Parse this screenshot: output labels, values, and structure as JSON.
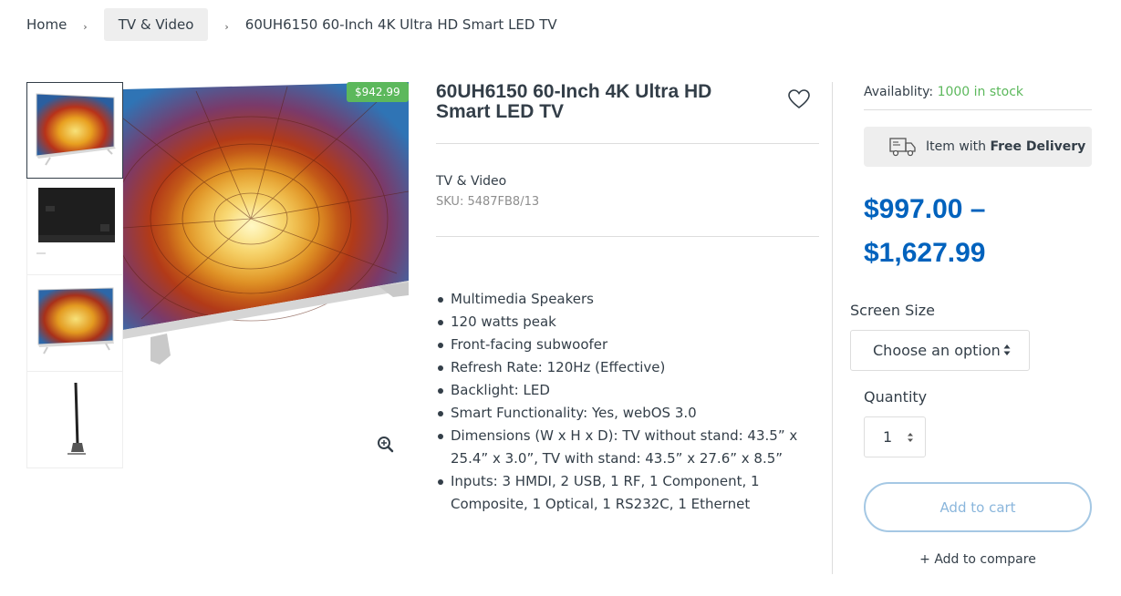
{
  "breadcrumb": {
    "home": "Home",
    "category": "TV & Video",
    "current": "60UH6150 60-Inch 4K Ultra HD Smart LED TV",
    "separator": "›"
  },
  "gallery": {
    "sale_price": "$942.99",
    "thumbnail_icons": [
      "tv-front-thumbnail",
      "tv-back-thumbnail",
      "tv-angle-thumbnail",
      "tv-side-thumbnail"
    ],
    "zoom_icon": "zoom-icon"
  },
  "product": {
    "title": "60UH6150 60-Inch 4K Ultra HD Smart LED TV",
    "category": "TV & Video",
    "sku": "SKU: 5487FB8/13",
    "specs": [
      "Multimedia Speakers",
      "120 watts peak",
      "Front-facing subwoofer",
      "Refresh Rate: 120Hz (Effective)",
      "Backlight: LED",
      "Smart Functionality: Yes, webOS 3.0",
      "Dimensions (W x H x D): TV without stand: 43.5” x 25.4” x 3.0”, TV with stand: 43.5” x 27.6” x 8.5”",
      "Inputs: 3 HMDI, 2 USB, 1 RF, 1 Component, 1 Composite, 1 Optical, 1 RS232C, 1 Ethernet"
    ]
  },
  "purchase": {
    "availability_label": "Availablity:",
    "availability_value": "1000 in stock",
    "delivery_prefix": "Item with",
    "delivery_bold": "Free Delivery",
    "price_line1": "$997.00 –",
    "price_line2": "$1,627.99",
    "screen_size_label": "Screen Size",
    "screen_size_value": "Choose an option",
    "quantity_label": "Quantity",
    "quantity_value": "1",
    "add_to_cart": "Add to cart",
    "compare": "+ Add to compare"
  },
  "colors": {
    "price": "#0062bd",
    "sale_badge": "#5cb85c",
    "in_stock": "#5cb85c",
    "add_to_cart_border": "#a5c8e4"
  }
}
